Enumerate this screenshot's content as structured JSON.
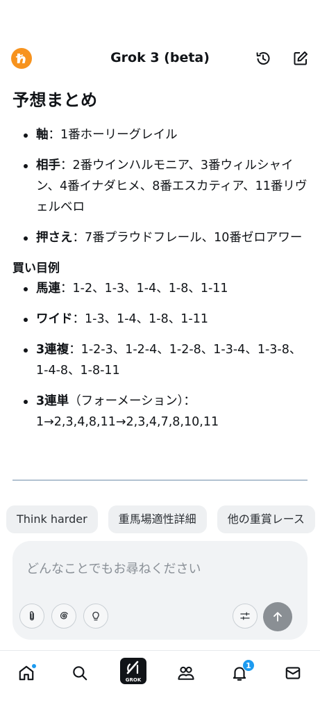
{
  "header": {
    "title": "Grok 3 (beta)"
  },
  "content": {
    "heading": "予想まとめ",
    "picks": [
      {
        "label": "軸",
        "text": "：1番ホーリーグレイル"
      },
      {
        "label": "相手",
        "text": "：2番ウインハルモニア、3番ウィルシャイン、4番イナダヒメ、8番エスカティア、11番リヴェルベロ"
      },
      {
        "label": "押さえ",
        "text": "：7番プラウドフレール、10番ゼロアワー"
      }
    ],
    "subheading": "買い目例",
    "bets": [
      {
        "label": "馬連",
        "text": "：1-2、1-3、1-4、1-8、1-11"
      },
      {
        "label": "ワイド",
        "text": "：1-3、1-4、1-8、1-11"
      },
      {
        "label": "3連複",
        "text": "：1-2-3、1-2-4、1-2-8、1-3-4、1-3-8、1-4-8、1-8-11"
      },
      {
        "label": "3連単",
        "text": "（フォーメーション）：1→2,3,4,8,11→2,3,4,7,8,10,11"
      }
    ]
  },
  "chips": [
    "Think harder",
    "重馬場適性詳細",
    "他の重賞レース"
  ],
  "composer": {
    "placeholder": "どんなことでもお尋ねください"
  },
  "tabbar": {
    "grok_label": "GROK",
    "notifications_count": "1"
  }
}
